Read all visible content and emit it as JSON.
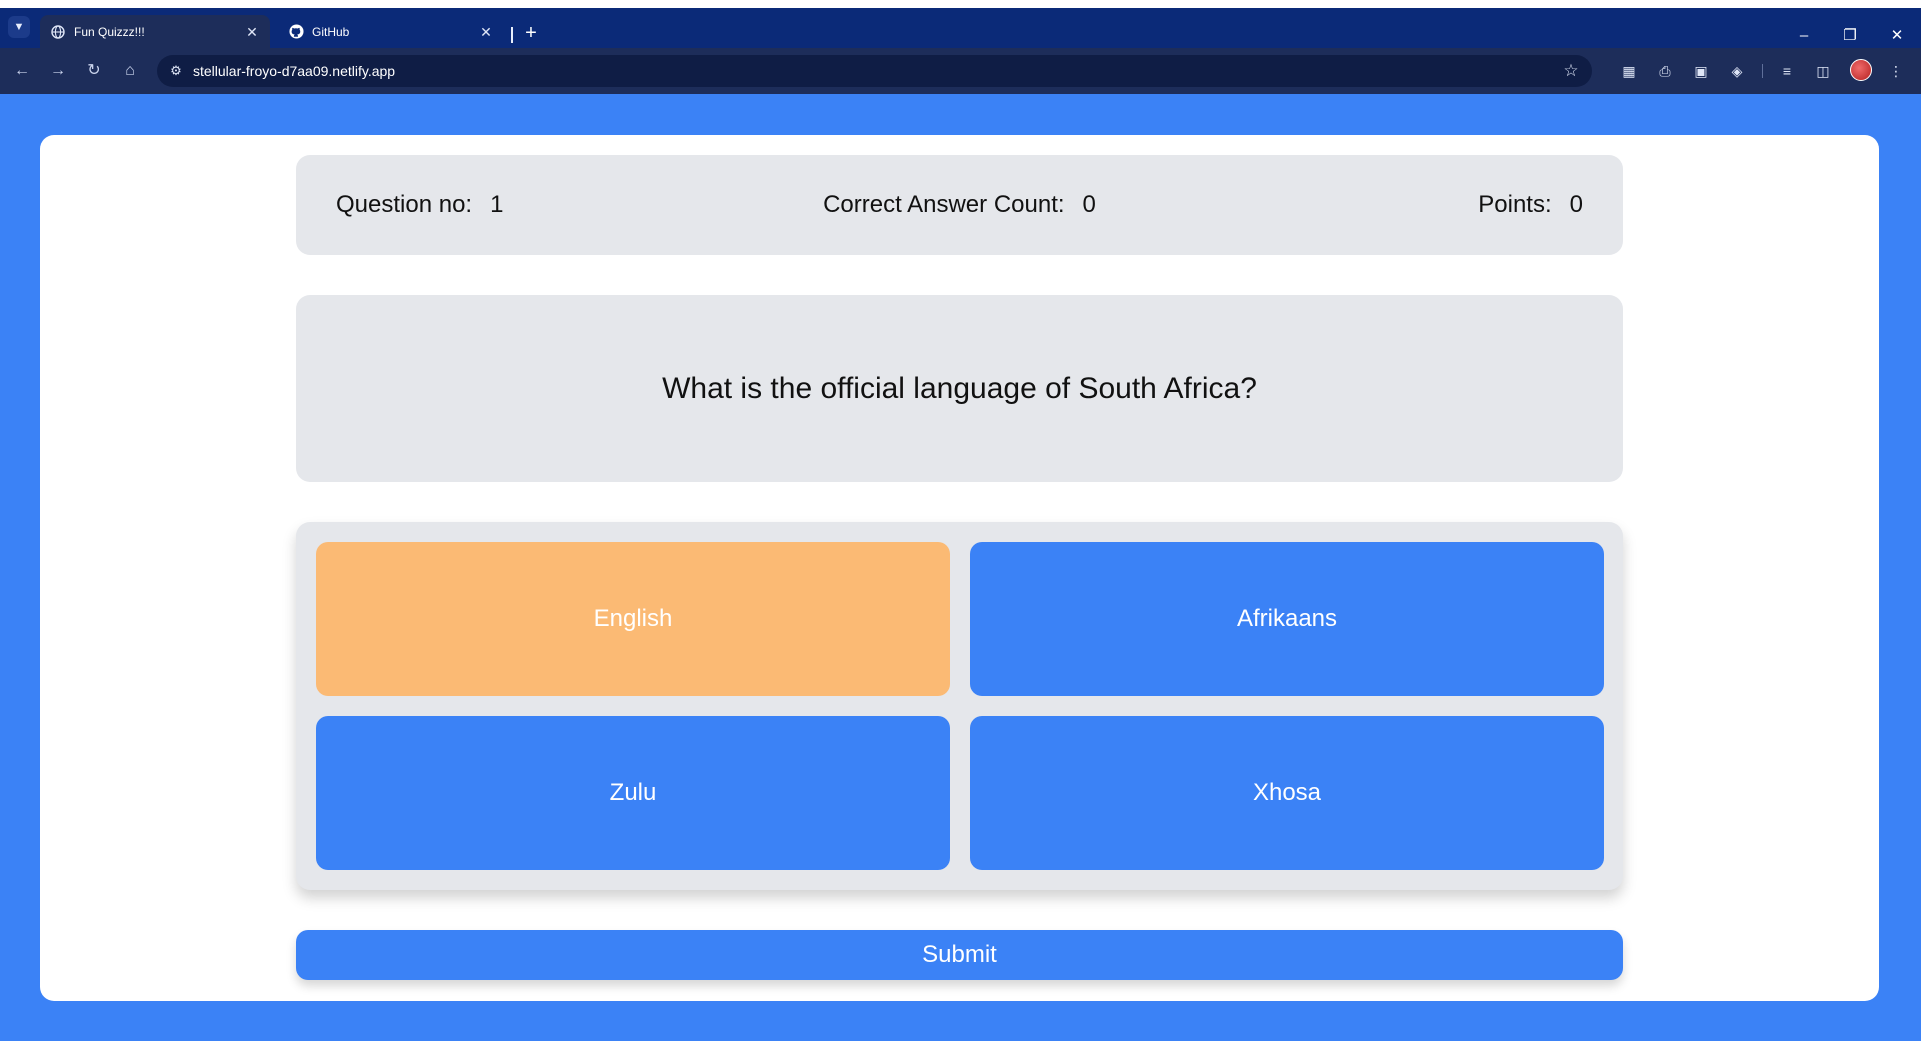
{
  "browser": {
    "tabs": [
      {
        "title": "Fun Quizzz!!!",
        "icon": "globe-icon",
        "active": true
      },
      {
        "title": "GitHub",
        "icon": "github-icon",
        "active": false
      }
    ],
    "url": "stellular-froyo-d7aa09.netlify.app",
    "theme_color": "#0b2a78",
    "toolbar_color": "#1d2d5a"
  },
  "quiz": {
    "stats": {
      "question_label": "Question no:",
      "question_value": "1",
      "correct_label": "Correct Answer Count:",
      "correct_value": "0",
      "points_label": "Points:",
      "points_value": "0"
    },
    "question": "What is the official language of South Africa?",
    "answers": [
      "English",
      "Afrikaans",
      "Zulu",
      "Xhosa"
    ],
    "selected_answer": "English",
    "submit_label": "Submit",
    "colors": {
      "page_background": "#3b82f6",
      "answer_button": "#3b82f6",
      "selected_answer": "#fbba74",
      "panel": "#e5e7eb"
    }
  }
}
